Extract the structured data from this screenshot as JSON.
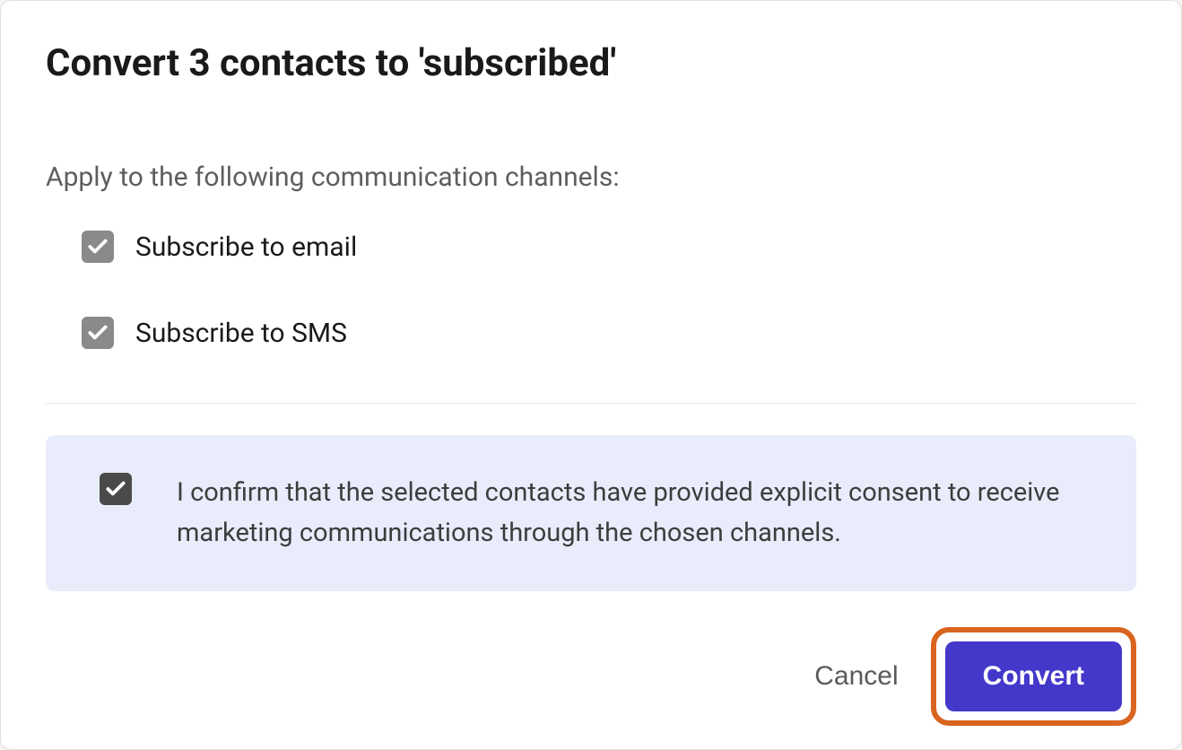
{
  "modal": {
    "title": "Convert 3 contacts to 'subscribed'",
    "instruction": "Apply to the following communication channels:",
    "channels": [
      {
        "label": "Subscribe to email",
        "checked": true
      },
      {
        "label": "Subscribe to SMS",
        "checked": true
      }
    ],
    "confirm": {
      "checked": true,
      "text": "I confirm that the selected contacts have provided explicit consent to receive marketing communications through the chosen channels."
    },
    "footer": {
      "cancel_label": "Cancel",
      "convert_label": "Convert"
    }
  },
  "colors": {
    "highlight_border": "#d9641f",
    "primary_button": "#4338ca",
    "confirm_bg": "#e8ecfb"
  }
}
